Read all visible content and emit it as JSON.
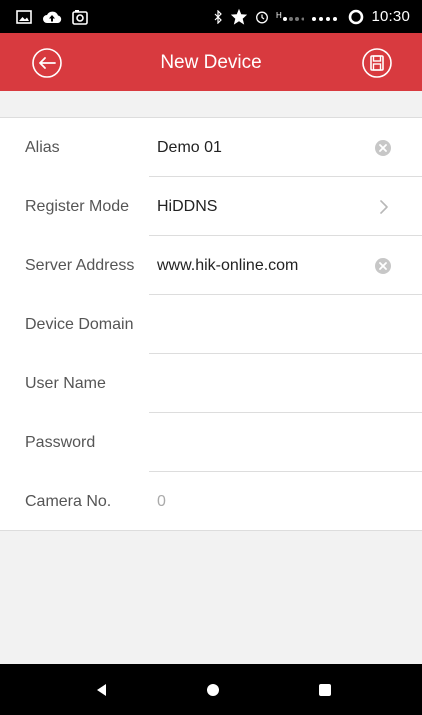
{
  "status_bar": {
    "time": "10:30",
    "icons": [
      "image-icon",
      "cloud-upload-icon",
      "camera-roll-icon",
      "bluetooth-icon",
      "star-icon",
      "alarm-icon",
      "signal-icon",
      "signal-icon",
      "circle-icon"
    ]
  },
  "app_bar": {
    "title": "New Device",
    "back_icon": "back-circle-icon",
    "save_icon": "save-icon",
    "color": "#d83a3f"
  },
  "form": {
    "fields": [
      {
        "label": "Alias",
        "value": "Demo 01",
        "control": "clear"
      },
      {
        "label": "Register Mode",
        "value": "HiDDNS",
        "control": "chevron"
      },
      {
        "label": "Server Address",
        "value": "www.hik-online.com",
        "control": "clear"
      },
      {
        "label": "Device Domain",
        "value": "",
        "control": "none"
      },
      {
        "label": "User Name",
        "value": "",
        "control": "none"
      },
      {
        "label": "Password",
        "value": "",
        "control": "none"
      },
      {
        "label": "Camera No.",
        "value": "",
        "placeholder": "0",
        "control": "none"
      }
    ]
  },
  "nav_bar": {
    "icons": [
      "nav-back-icon",
      "nav-home-icon",
      "nav-recents-icon"
    ]
  }
}
